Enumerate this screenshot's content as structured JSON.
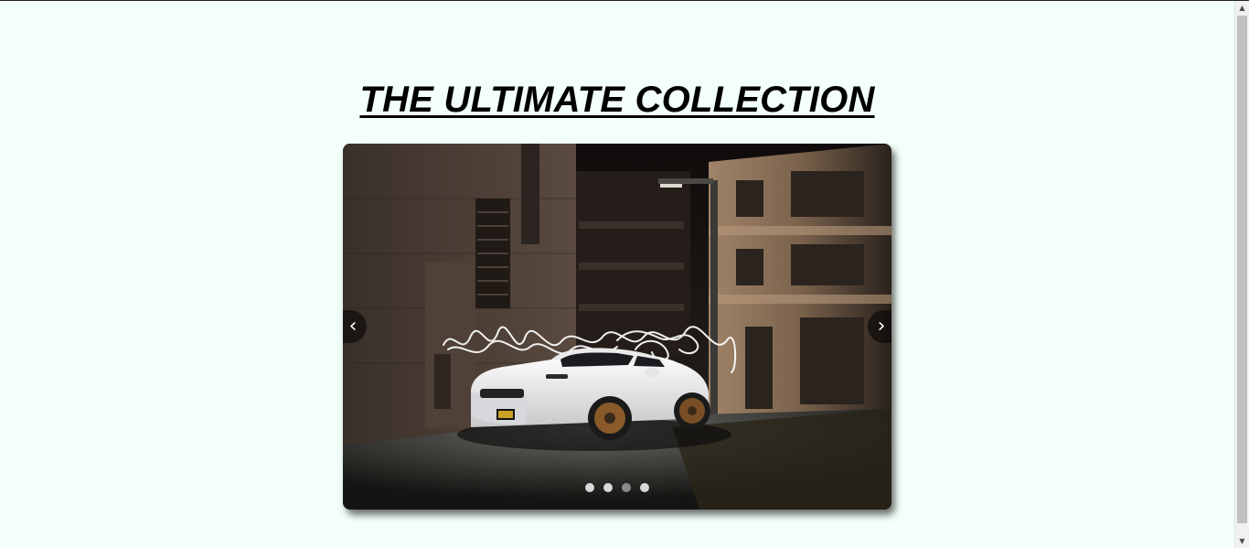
{
  "page": {
    "title": "THE ULTIMATE COLLECTION"
  },
  "slider": {
    "image_alt": "White Dodge Challenger muscle car parked at night between brick buildings with light-painting trails",
    "prev_label": "‹",
    "next_label": "›",
    "slide_count": 4,
    "active_slide_index": 2
  },
  "scrollbar": {
    "up_arrow": "▲",
    "down_arrow": "▼"
  },
  "colors": {
    "background": "#f3fff9",
    "title": "#000000",
    "dot": "#d8d8d8",
    "dot_active": "#8a8a8a"
  }
}
